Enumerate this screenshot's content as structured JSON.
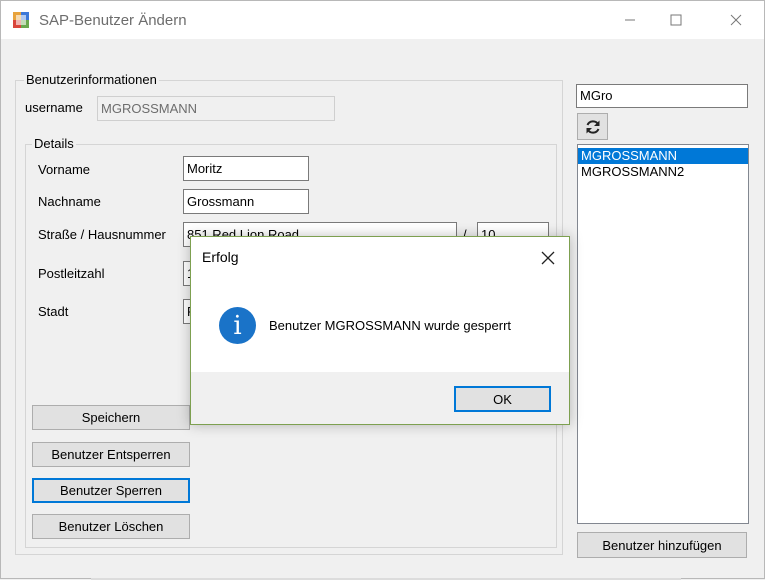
{
  "window": {
    "title": "SAP-Benutzer Ändern"
  },
  "userinfo": {
    "group_title": "Benutzerinformationen",
    "username_label": "username",
    "username_value": "MGROSSMANN"
  },
  "details": {
    "group_title": "Details",
    "vorname_label": "Vorname",
    "vorname_value": "Moritz",
    "nachname_label": "Nachname",
    "nachname_value": "Grossmann",
    "strasse_label": "Straße / Hausnummer",
    "strasse_value": "851 Red Lion Road",
    "separator": "/",
    "hausnummer_value": "10",
    "plz_label": "Postleitzahl",
    "plz_value": "1",
    "stadt_label": "Stadt",
    "stadt_value": "F"
  },
  "actions": {
    "save": "Speichern",
    "unlock": "Benutzer Entsperren",
    "lock": "Benutzer Sperren",
    "delete": "Benutzer Löschen"
  },
  "search": {
    "value": "MGro"
  },
  "user_list": [
    "MGROSSMANN",
    "MGROSSMANN2"
  ],
  "add_user": "Benutzer hinzufügen",
  "dialog": {
    "title": "Erfolg",
    "message": "Benutzer MGROSSMANN wurde gesperrt",
    "ok": "OK"
  },
  "icons": {
    "app": "sap-app-icon",
    "refresh": "refresh-icon",
    "info": "info-icon",
    "close": "close-icon"
  },
  "colors": {
    "accent": "#0078d7",
    "info": "#1a73c8",
    "dialog_border": "#7da050"
  }
}
